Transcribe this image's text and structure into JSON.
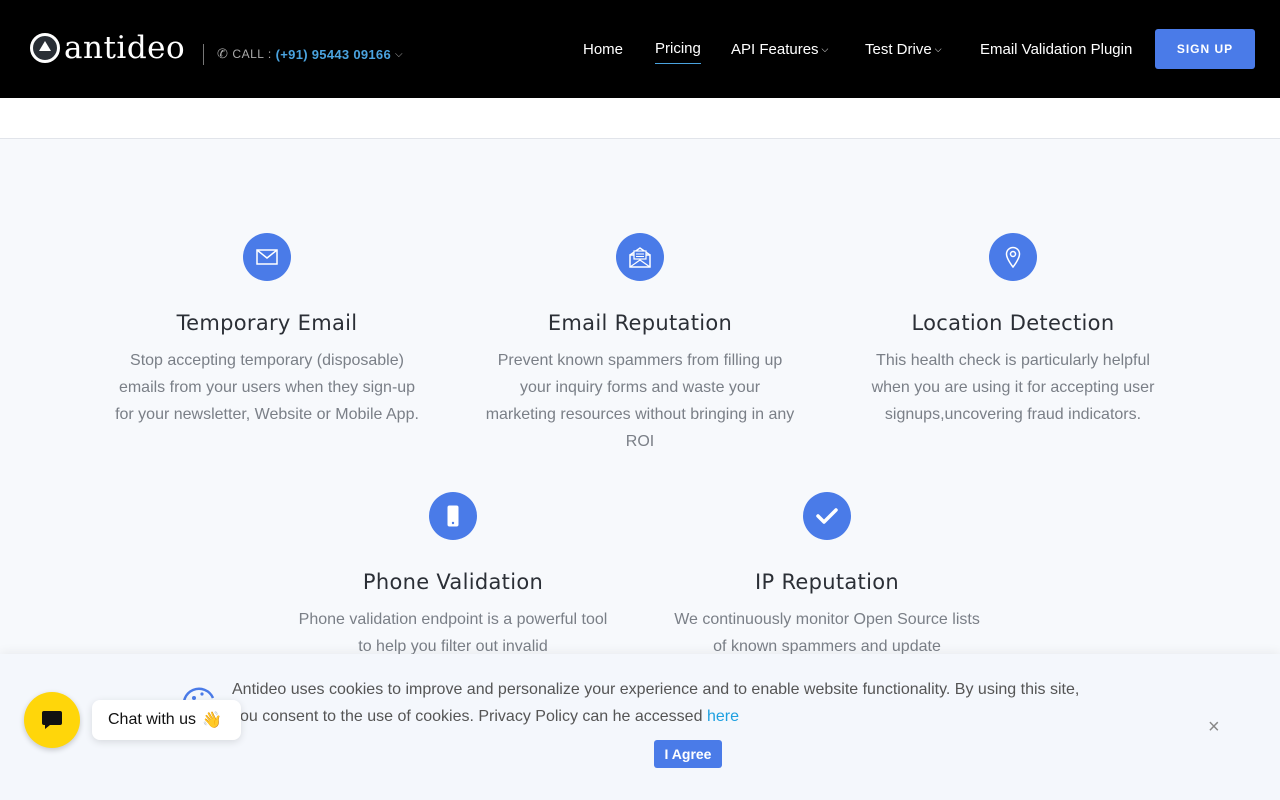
{
  "header": {
    "logo_text": "antideo",
    "call_label": "CALL :",
    "call_number": "(+91) 95443 09166",
    "nav": [
      {
        "label": "Home"
      },
      {
        "label": "Pricing",
        "active": true
      },
      {
        "label": "API Features",
        "dropdown": true
      },
      {
        "label": "Test Drive",
        "dropdown": true
      },
      {
        "label": "Email Validation Plugin"
      }
    ],
    "signup_label": "SIGN UP"
  },
  "features": [
    {
      "icon": "envelope-icon",
      "title": "Temporary Email",
      "text": "Stop accepting temporary (disposable) emails from your users when they sign-up for your newsletter, Website or Mobile App."
    },
    {
      "icon": "open-envelope-icon",
      "title": "Email Reputation",
      "text": "Prevent known spammers from filling up your inquiry forms and waste your marketing resources without bringing in any ROI"
    },
    {
      "icon": "location-pin-icon",
      "title": "Location Detection",
      "text": "This health check is particularly helpful when you are using it for accepting user signups,uncovering fraud indicators."
    },
    {
      "icon": "mobile-phone-icon",
      "title": "Phone Validation",
      "text": "Phone validation endpoint is a powerful tool to help you filter out invalid"
    },
    {
      "icon": "check-icon",
      "title": "IP Reputation",
      "text": "We continuously monitor Open Source lists of known spammers and update"
    }
  ],
  "cookie": {
    "text": "Antideo uses cookies to improve and personalize your experience and to enable website functionality. By using this site, you consent to the use of cookies. Privacy Policy can he accessed",
    "link": "here",
    "agree_label": "I Agree",
    "close": "×"
  },
  "chat": {
    "label": "Chat with us",
    "emoji": "👋"
  },
  "colors": {
    "accent": "#4a7be8",
    "link": "#4aa3df",
    "chat": "#ffd60a",
    "header_bg": "#000000"
  }
}
